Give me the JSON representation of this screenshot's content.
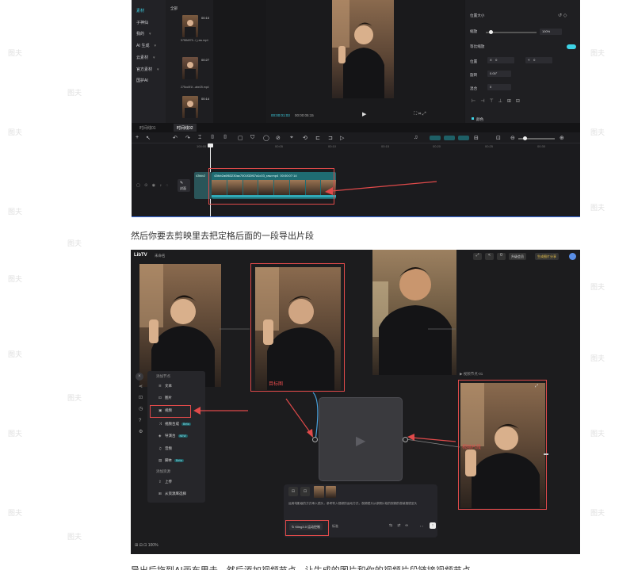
{
  "editor": {
    "categories": [
      {
        "label": "素材",
        "active": true
      },
      {
        "label": "子神仙",
        "active": false
      },
      {
        "label": "我的",
        "active": false
      },
      {
        "label": "AI 生成",
        "active": false
      },
      {
        "label": "云素材",
        "active": false
      },
      {
        "label": "官方素材",
        "active": false
      },
      {
        "label": "国护AI",
        "active": false
      }
    ],
    "media_filter": "全部",
    "media": [
      {
        "duration": "00:10",
        "name": "57f8fd975...f_raw.mp4"
      },
      {
        "duration": "00:27",
        "name": "275cc0f1f...abe25.mp4"
      },
      {
        "duration": "00:14",
        "name": ""
      }
    ],
    "player": {
      "current": "00:00:01:03",
      "total": "00:00:05:15"
    },
    "props": {
      "position_size": "位置大小",
      "scale_label": "缩放",
      "scale_value": "100%",
      "uniform_label": "等比缩放",
      "pos_label": "位置",
      "x_label": "X",
      "x_value": "0",
      "y_label": "Y",
      "y_value": "0",
      "rotate_label": "旋转",
      "rotate_value": "0.00°",
      "mirror_label": "混合",
      "mirror_value": "0"
    },
    "tabs": [
      "时间线01",
      "时间线02"
    ],
    "ruler": [
      "100:00",
      "00:05",
      "00:10",
      "00:15",
      "00:20",
      "00:25",
      "00:30"
    ],
    "clip_name": "43fcb2a6f63230ac7001f32f67a1c03_raw.mp4",
    "clip_duration": "00:00:07:14",
    "clip_prefix": "43fcb2",
    "track_label": "封面",
    "section_label": "颜色"
  },
  "caption": "然后你要去剪映里去把定格后面的一段导出片段",
  "canvas": {
    "logo": "LibTV",
    "project": "未命名",
    "credits": "0",
    "upgrade": "升级会员",
    "share": "生成图片分享",
    "node_image_label": "目标图",
    "node_video_label": "视频片段",
    "panel_title": "添加节点",
    "panel_items": [
      {
        "label": "文本",
        "icon": "text-icon",
        "badge": ""
      },
      {
        "label": "图片",
        "icon": "image-icon",
        "badge": ""
      },
      {
        "label": "视频",
        "icon": "video-icon",
        "badge": ""
      },
      {
        "label": "视频合成",
        "icon": "merge-icon",
        "badge": "Beta"
      },
      {
        "label": "导演台",
        "icon": "director-icon",
        "badge": "NEW"
      },
      {
        "label": "音频",
        "icon": "audio-icon",
        "badge": ""
      },
      {
        "label": "脚本",
        "icon": "script-icon",
        "badge": "Beta"
      }
    ],
    "panel_section2": "添加资源",
    "panel_upload": "上传",
    "panel_library": "从资源库选择",
    "right_node_title": "▶ 视频节点-01",
    "prompt_text": "运用电影级的方式串入镜头，参考导入视频的运动方式，视频镜头从参照片段的视频的首帧推镜至头",
    "model_label": "Kling3.0 运动控制",
    "mode_label": "标准",
    "zoom": "100%"
  },
  "bottom_text": "导出后拖到AI画布里去，然后添加视频节点，让生成的图片和你的视频片段链接视频节点",
  "watermark": "图夫"
}
